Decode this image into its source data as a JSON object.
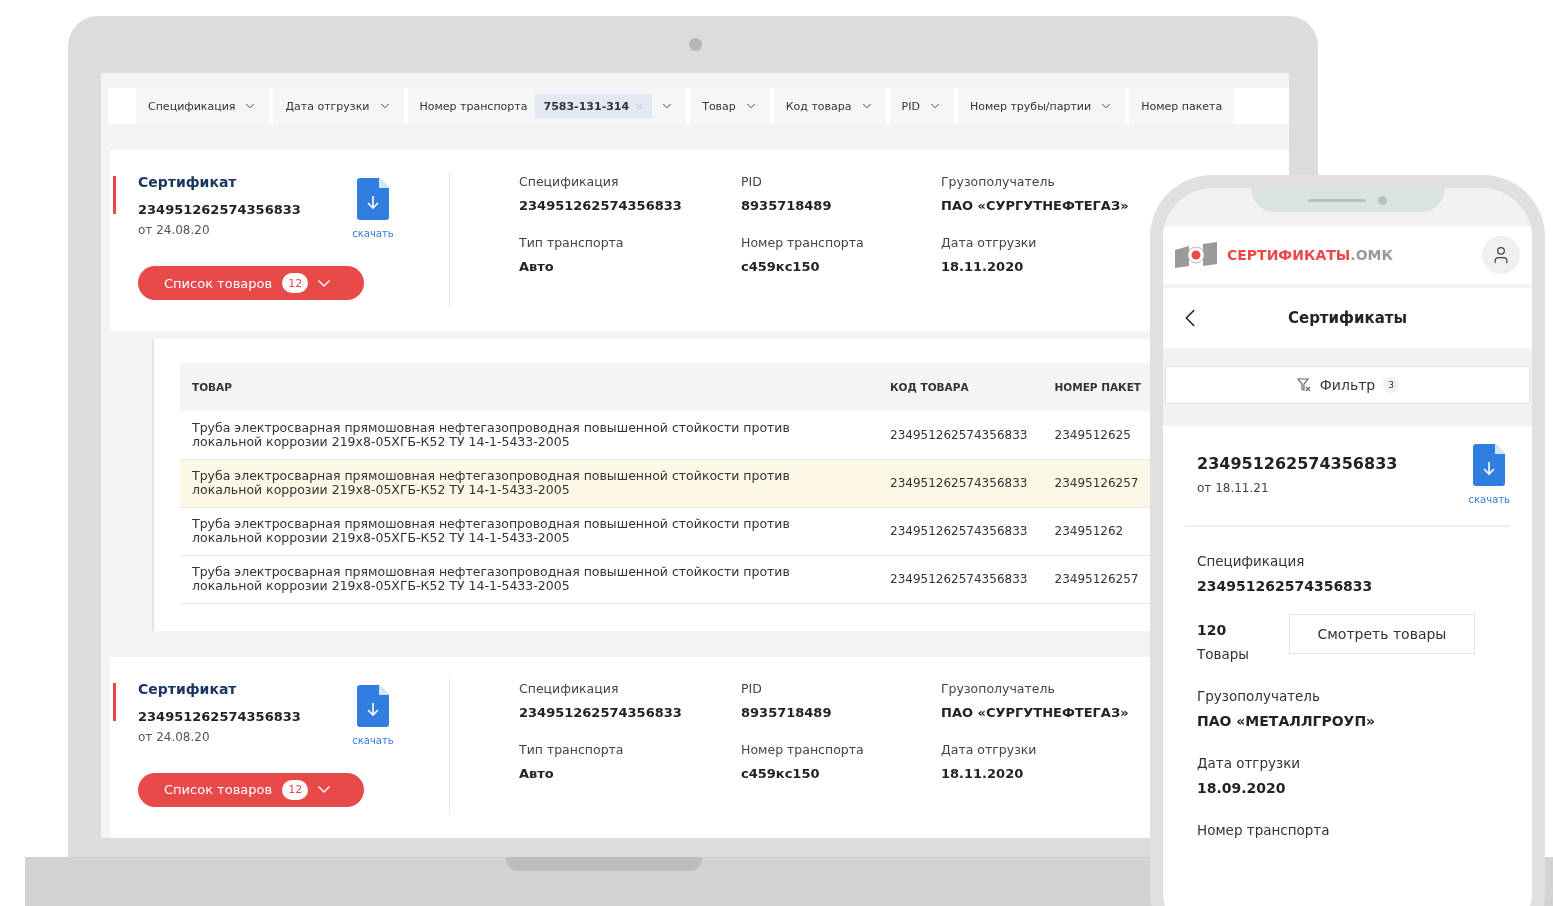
{
  "filters": [
    {
      "kind": "dropdown",
      "label": "Спецификация"
    },
    {
      "kind": "dropdown",
      "label": "Дата отгрузки"
    },
    {
      "kind": "dropdown",
      "label": "Номер транспорта",
      "value": "7583-131-314"
    },
    {
      "kind": "dropdown",
      "label": "Товар"
    },
    {
      "kind": "dropdown",
      "label": "Код товара"
    },
    {
      "kind": "dropdown",
      "label": "PID"
    },
    {
      "kind": "dropdown",
      "label": "Номер трубы/партии"
    },
    {
      "kind": "label",
      "label": "Номер пакета"
    }
  ],
  "certificates": [
    {
      "title": "Сертификат",
      "number": "234951262574356833",
      "date": "от 24.08.20",
      "download": "скачать",
      "list_button": {
        "label": "Список товаров",
        "count": "12"
      },
      "fields": [
        {
          "label": "Спецификация",
          "value": "234951262574356833"
        },
        {
          "label": "PID",
          "value": "8935718489"
        },
        {
          "label": "Грузополучатель",
          "value": "ПАО «СУРГУТНЕФТЕГАЗ»"
        },
        {
          "label": "Тип транспорта",
          "value": "Авто"
        },
        {
          "label": "Номер транспорта",
          "value": "с459кс150"
        },
        {
          "label": "Дата отгрузки",
          "value": "18.11.2020"
        }
      ],
      "table": {
        "columns": [
          "ТОВАР",
          "КОД ТОВАРА",
          "НОМЕР ПАКЕТ"
        ],
        "rows": [
          {
            "selected": false,
            "cells": [
              "Труба электросварная прямошовная нефтегазопроводная повышенной стойкости против локальной коррозии 219х8-05ХГБ-К52 ТУ 14-1-5433-2005",
              "234951262574356833",
              "2349512625"
            ]
          },
          {
            "selected": true,
            "cells": [
              "Труба электросварная прямошовная нефтегазопроводная повышенной стойкости против локальной коррозии 219х8-05ХГБ-К52 ТУ 14-1-5433-2005",
              "234951262574356833",
              "23495126257"
            ]
          },
          {
            "selected": false,
            "cells": [
              "Труба электросварная прямошовная нефтегазопроводная повышенной стойкости против локальной коррозии 219х8-05ХГБ-К52 ТУ 14-1-5433-2005",
              "234951262574356833",
              "234951262"
            ]
          },
          {
            "selected": false,
            "cells": [
              "Труба электросварная прямошовная нефтегазопроводная повышенной стойкости против локальной коррозии 219х8-05ХГБ-К52 ТУ 14-1-5433-2005",
              "234951262574356833",
              "23495126257"
            ]
          }
        ]
      }
    },
    {
      "title": "Сертификат",
      "number": "234951262574356833",
      "date": "от 24.08.20",
      "download": "скачать",
      "list_button": {
        "label": "Список товаров",
        "count": "12"
      },
      "fields": [
        {
          "label": "Спецификация",
          "value": "234951262574356833"
        },
        {
          "label": "PID",
          "value": "8935718489"
        },
        {
          "label": "Грузополучатель",
          "value": "ПАО «СУРГУТНЕФТЕГАЗ»"
        },
        {
          "label": "Тип транспорта",
          "value": "Авто"
        },
        {
          "label": "Номер транспорта",
          "value": "с459кс150"
        },
        {
          "label": "Дата отгрузки",
          "value": "18.11.2020"
        }
      ]
    }
  ],
  "mobile": {
    "logo": {
      "brand": "СЕРТИФИКАТЫ",
      "suffix": ".ОМК"
    },
    "title": "Сертификаты",
    "filter": {
      "label": "Фильтр",
      "count": "3"
    },
    "card": {
      "number": "234951262574356833",
      "date": "от 18.11.21",
      "download": "скачать"
    },
    "fields": [
      {
        "kind": "field",
        "label": "Спецификация",
        "value": "234951262574356833"
      },
      {
        "kind": "count",
        "value": "120",
        "label": "Товары",
        "button": "Смотреть товары"
      },
      {
        "kind": "field",
        "label": "Грузополучатель",
        "value": "ПАО «МЕТАЛЛГРОУП»"
      },
      {
        "kind": "field",
        "label": "Дата отгрузки",
        "value": "18.09.2020"
      },
      {
        "kind": "field",
        "label": "Номер транспорта"
      }
    ]
  }
}
